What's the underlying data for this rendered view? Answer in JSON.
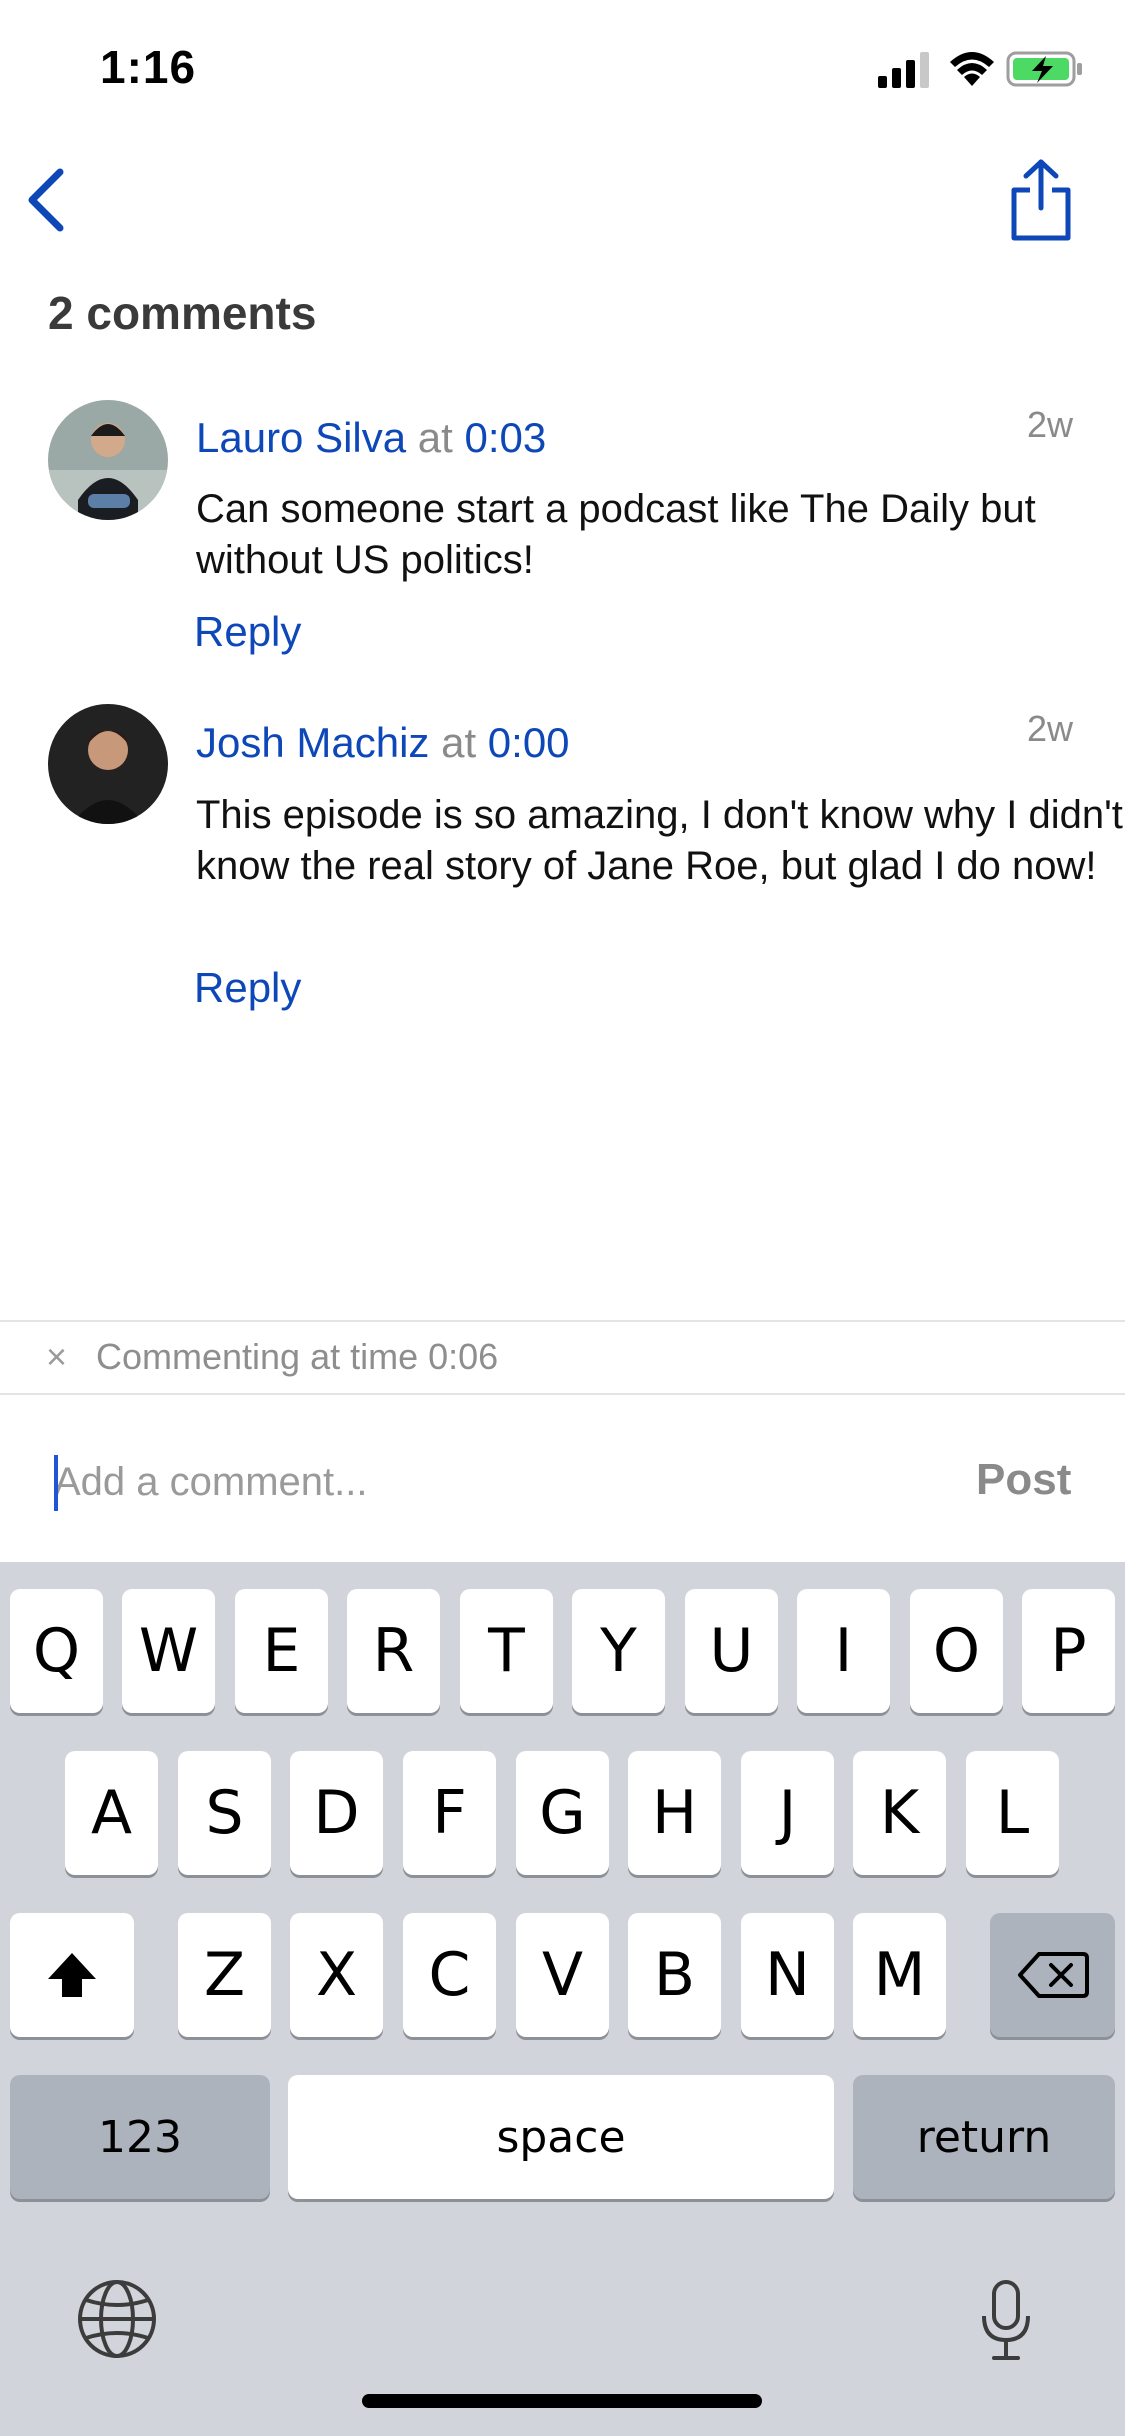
{
  "status_bar": {
    "time": "1:16"
  },
  "header": {
    "comments_count": "2 comments"
  },
  "comments": [
    {
      "author": "Lauro Silva",
      "at": "at",
      "timestamp": "0:03",
      "text": "Can someone start a podcast like The Daily but without US politics!",
      "age": "2w",
      "reply_label": "Reply"
    },
    {
      "author": "Josh Machiz",
      "at": "at",
      "timestamp": "0:00",
      "text": "This episode is so amazing, I don't know why I didn't know the real story of Jane Roe, but glad I do now!",
      "age": "2w",
      "reply_label": "Reply"
    }
  ],
  "commenting_bar": {
    "close_glyph": "×",
    "text": "Commenting at time 0:06"
  },
  "composer": {
    "placeholder": "Add a comment...",
    "value": "",
    "post_label": "Post"
  },
  "keyboard": {
    "row1": [
      "Q",
      "W",
      "E",
      "R",
      "T",
      "Y",
      "U",
      "I",
      "O",
      "P"
    ],
    "row2": [
      "A",
      "S",
      "D",
      "F",
      "G",
      "H",
      "J",
      "K",
      "L"
    ],
    "row3": [
      "Z",
      "X",
      "C",
      "V",
      "B",
      "N",
      "M"
    ],
    "numbers_label": "123",
    "space_label": "space",
    "return_label": "return"
  },
  "colors": {
    "accent": "#0d47b8",
    "muted": "#8a8a8a",
    "keyboard_bg": "#d1d4db"
  }
}
